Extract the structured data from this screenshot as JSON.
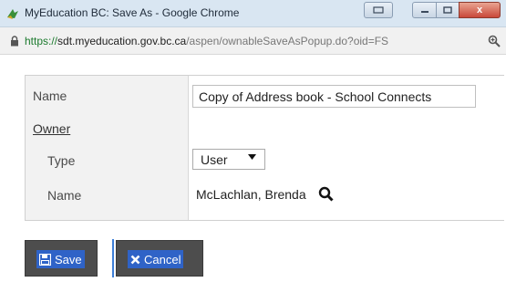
{
  "window": {
    "title": "MyEducation BC: Save As - Google Chrome",
    "close_glyph": "x"
  },
  "address_bar": {
    "url_scheme": "https://",
    "url_host": "sdt.myeducation.gov.bc.ca",
    "url_path": "/aspen/ownableSaveAsPopup.do?oid=FS"
  },
  "form": {
    "name_label": "Name",
    "name_value": "Copy of Address book - School Connects",
    "owner_label": "Owner",
    "type_label": "Type",
    "type_value": "User",
    "owner_name_label": "Name",
    "owner_name_value": "McLachlan, Brenda"
  },
  "buttons": {
    "save_label": "Save",
    "cancel_label": "Cancel"
  },
  "icons": {
    "app": "chrome-app-icon",
    "lock": "lock-icon",
    "zoom": "zoom-icon",
    "search": "search-icon",
    "save": "floppy-disk-icon",
    "cancel": "x-icon",
    "dropdown": "triangle-down-icon"
  },
  "colors": {
    "titlebar": "#d9e6f2",
    "button_bg": "#4d4d4d",
    "button_highlight": "#2f63c7",
    "url_scheme": "#1c7a2e"
  }
}
